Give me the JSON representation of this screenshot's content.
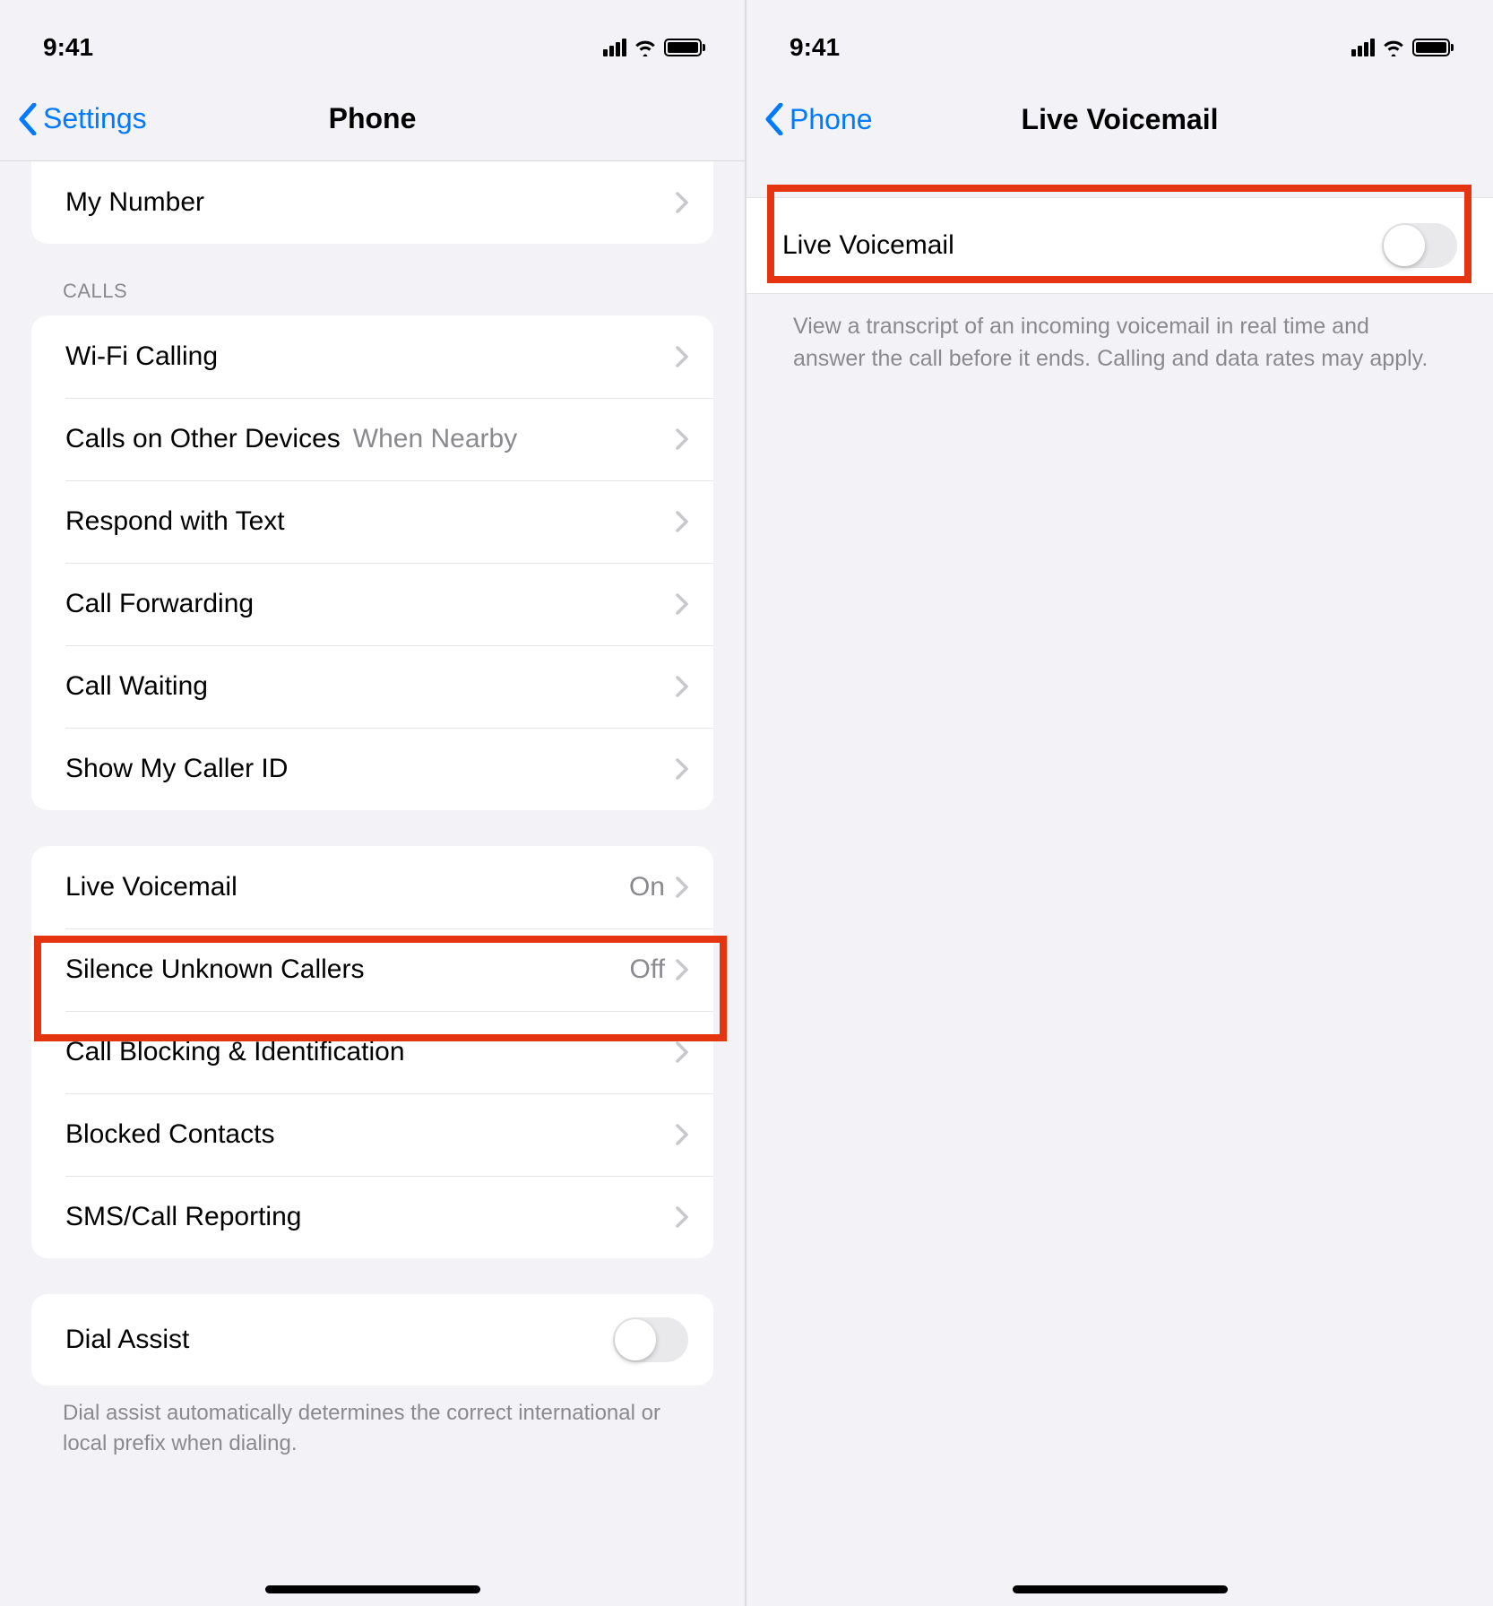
{
  "status": {
    "time": "9:41"
  },
  "left": {
    "back_label": "Settings",
    "title": "Phone",
    "group1": {
      "my_number": "My Number"
    },
    "calls_header": "CALLS",
    "calls": {
      "wifi_calling": "Wi-Fi Calling",
      "calls_other_devices": "Calls on Other Devices",
      "calls_other_devices_value": "When Nearby",
      "respond_with_text": "Respond with Text",
      "call_forwarding": "Call Forwarding",
      "call_waiting": "Call Waiting",
      "show_caller_id": "Show My Caller ID"
    },
    "group3": {
      "live_voicemail": "Live Voicemail",
      "live_voicemail_value": "On",
      "silence_unknown": "Silence Unknown Callers",
      "silence_unknown_value": "Off",
      "call_blocking": "Call Blocking & Identification",
      "blocked_contacts": "Blocked Contacts",
      "sms_call_reporting": "SMS/Call Reporting"
    },
    "group4": {
      "dial_assist": "Dial Assist",
      "dial_assist_footer": "Dial assist automatically determines the correct international or local prefix when dialing."
    }
  },
  "right": {
    "back_label": "Phone",
    "title": "Live Voicemail",
    "row_label": "Live Voicemail",
    "description": "View a transcript of an incoming voicemail in real time and answer the call before it ends. Calling and data rates may apply."
  }
}
